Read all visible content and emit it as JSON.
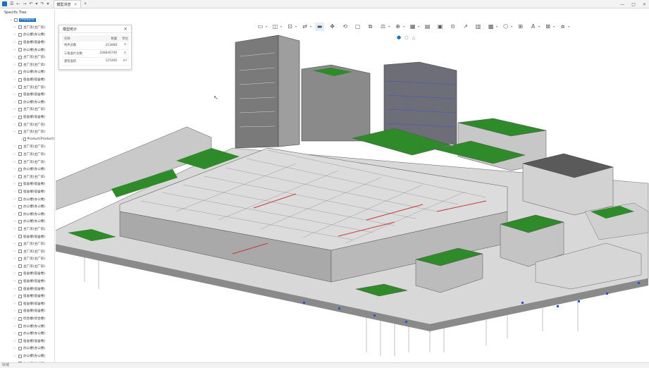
{
  "app": {
    "quick_access": [
      "☰",
      "←",
      "→",
      "↶",
      "▾",
      "↷",
      "▾"
    ],
    "tab_title": "模型浏览",
    "tab_close": "×",
    "new_tab": "+",
    "window_controls": [
      "—",
      "□",
      "×"
    ]
  },
  "tree": {
    "header": "Specific Tree",
    "root_label": "Products",
    "items": [
      "主厂房(主厂房)",
      "办公楼(办公楼)",
      "宿舍楼(宿舍楼)",
      "办公楼(办公楼)",
      "主厂房(主厂房)",
      "主厂房(主厂房)",
      "办公楼(办公楼)",
      "宿舍楼(宿舍楼)",
      "主厂房(主厂房)",
      "宿舍楼(宿舍楼)",
      "办公楼(办公楼)",
      "主厂房(主厂房)",
      "宿舍楼(宿舍楼)",
      "主厂房(主厂房)",
      "主厂房(主厂房)"
    ],
    "child_item": "Product(Product)",
    "items2": [
      "主厂房(主厂房)",
      "主厂房(主厂房)",
      "主厂房(主厂房)",
      "办公楼(办公楼)",
      "主厂房(主厂房)",
      "宿舍楼(宿舍楼)",
      "宿舍楼(宿舍楼)",
      "办公楼(办公楼)",
      "办公楼(办公楼)",
      "办公楼(办公楼)",
      "办公楼(办公楼)",
      "主厂房(主厂房)",
      "宿舍楼(宿舍楼)",
      "主厂房(主厂房)",
      "主厂房(主厂房)",
      "主厂房(主厂房)",
      "主厂房(主厂房)",
      "宿舍楼(宿舍楼)",
      "宿舍楼(宿舍楼)",
      "宿舍楼(宿舍楼)",
      "宿舍楼(宿舍楼)",
      "宿舍楼(宿舍楼)",
      "宿舍楼(宿舍楼)",
      "综合楼(综合楼)",
      "办公楼(办公楼)",
      "办公楼(办公楼)",
      "宿舍楼(宿舍楼)",
      "办公楼(办公楼)",
      "办公楼(办公楼)",
      "办公楼(办公楼)",
      "办公楼(办公楼)"
    ]
  },
  "stats_panel": {
    "title": "模型统计",
    "close": "×",
    "headers": [
      "名称",
      "数量",
      "单位"
    ],
    "rows": [
      {
        "name": "构件总数",
        "value": "253888",
        "unit": "个"
      },
      {
        "name": "三角面片总数",
        "value": "208846746",
        "unit": "个"
      },
      {
        "name": "建筑面积",
        "value": "125460",
        "unit": "m²"
      }
    ]
  },
  "toolbar": {
    "icons": [
      "view-cube-icon",
      "section-icon",
      "measure-icon",
      "walk-icon",
      "camera-icon",
      "rotate-icon",
      "zoom-window-icon",
      "zoom-all-icon",
      "pan-icon",
      "explode-icon",
      "layers-icon",
      "transparency-icon",
      "properties-icon",
      "clip-box-icon",
      "annotation-icon",
      "markup-icon",
      "rendering-icon",
      "grid-icon",
      "cube-icon",
      "settings-icon",
      "text-icon",
      "fit-icon",
      "snapshot-icon"
    ]
  },
  "subtool": [
    "●",
    "▢",
    "△"
  ],
  "status": {
    "text": "就绪"
  },
  "colors": {
    "accent": "#1f6fc0",
    "roof_green": "#2f8a2a",
    "pipe_red": "#c63a3a",
    "pile_blue": "#2f4fd6",
    "building_grey": "#c9c9c9"
  }
}
